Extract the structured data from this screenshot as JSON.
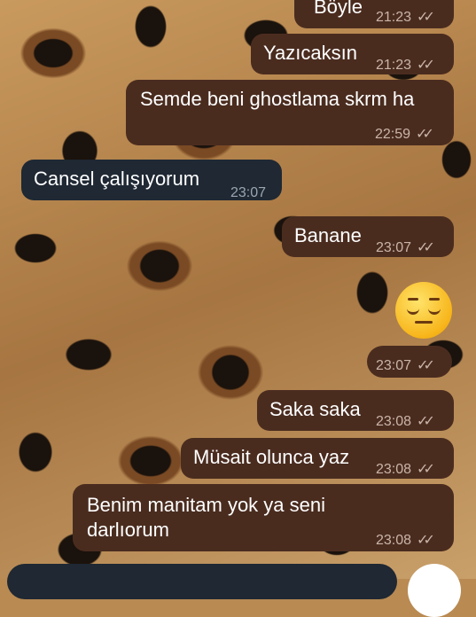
{
  "messages": [
    {
      "id": "m1",
      "direction": "out",
      "text": "Böyle",
      "time": "21:23",
      "status": "read"
    },
    {
      "id": "m2",
      "direction": "out",
      "text": "Yazıcaksın",
      "time": "21:23",
      "status": "read"
    },
    {
      "id": "m3",
      "direction": "out",
      "text": "Semde beni ghostlama skrm ha",
      "time": "22:59",
      "status": "read"
    },
    {
      "id": "m4",
      "direction": "in",
      "text": "Cansel çalışıyorum",
      "time": "23:07"
    },
    {
      "id": "m5",
      "direction": "out",
      "text": "Banane",
      "time": "23:07",
      "status": "read"
    },
    {
      "id": "m6",
      "direction": "out",
      "emoji": "pensive-face",
      "time": "23:07",
      "status": "read"
    },
    {
      "id": "m7",
      "direction": "out",
      "text": "Saka saka",
      "time": "23:08",
      "status": "read"
    },
    {
      "id": "m8",
      "direction": "out",
      "text": "Müsait olunca yaz",
      "time": "23:08",
      "status": "read"
    },
    {
      "id": "m9",
      "direction": "out",
      "text_lines": [
        "Benim manitam yok ya seni",
        "darlıorum"
      ],
      "time": "23:08",
      "status": "read"
    }
  ],
  "colors": {
    "outgoing_bubble": "#4a2c1f",
    "incoming_bubble": "#1f2833",
    "text": "#ffffff",
    "meta": "#c9b5a8"
  },
  "icons": {
    "read_receipt": "double-check-icon"
  }
}
